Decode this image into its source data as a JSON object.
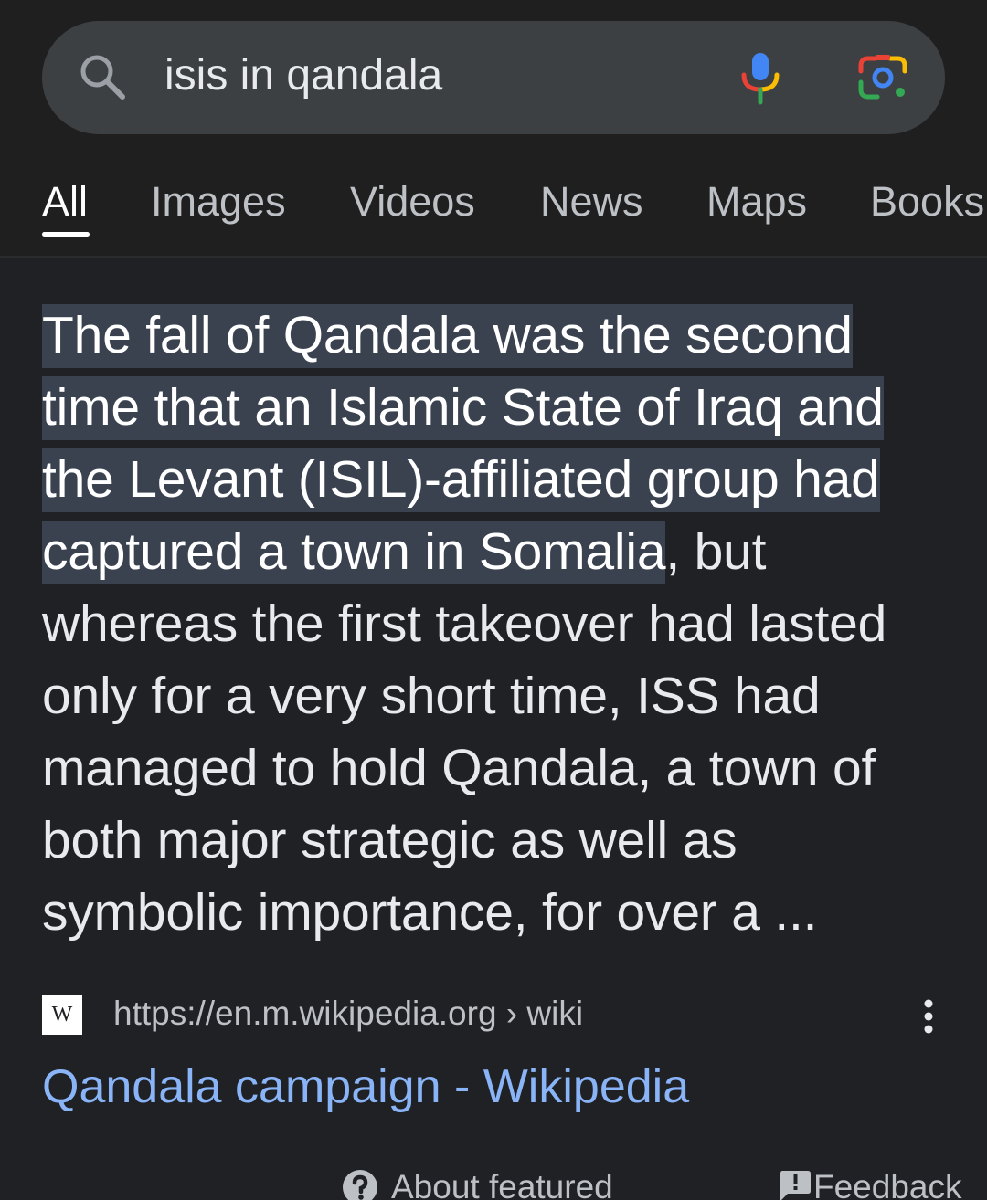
{
  "search": {
    "query": "isis in qandala"
  },
  "tabs": [
    {
      "label": "All",
      "active": true
    },
    {
      "label": "Images",
      "active": false
    },
    {
      "label": "Videos",
      "active": false
    },
    {
      "label": "News",
      "active": false
    },
    {
      "label": "Maps",
      "active": false
    },
    {
      "label": "Books",
      "active": false
    }
  ],
  "featured_snippet": {
    "highlighted_text": "The fall of Qandala was the second time that an Islamic State of Iraq and the Levant (ISIL)-affiliated group had captured a town in Somalia",
    "rest_text": ", but whereas the first takeover had lasted only for a very short time, ISS had managed to hold Qandala, a town of both major strategic as well as symbolic importance, for over a ..."
  },
  "source": {
    "favicon_letter": "W",
    "url": "https://en.m.wikipedia.org › wiki",
    "title": "Qandala campaign - Wikipedia"
  },
  "footer": {
    "about_label": "About featured",
    "feedback_label": "Feedback"
  },
  "colors": {
    "background": "#202124",
    "search_box": "#3c4043",
    "highlight": "#3a4250",
    "link": "#8ab4f8",
    "google_blue": "#4285f4",
    "google_red": "#ea4335",
    "google_yellow": "#fbbc04",
    "google_green": "#34a853"
  },
  "icons": {
    "search": "search-icon",
    "voice": "mic-icon",
    "lens": "google-lens-icon",
    "more": "more-vertical-icon",
    "help": "help-circle-icon",
    "feedback": "feedback-icon"
  }
}
